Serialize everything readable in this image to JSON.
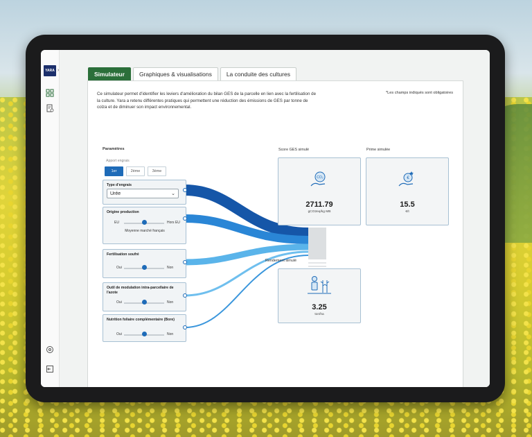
{
  "tabs": [
    {
      "label": "Simulateur",
      "active": true
    },
    {
      "label": "Graphiques & visualisations",
      "active": false
    },
    {
      "label": "La conduite des cultures",
      "active": false
    }
  ],
  "logo_text": "YARA",
  "intro": "Ce simulateur permet d'identifier les leviers d'amélioration du bilan GES de la parcelle en lien avec la fertilisation de la culture. Yara a retenu différentes pratiques qui permettent une réduction des émissions de GES par tonne de colza et de diminuer son impact environnemental.",
  "required_note": "*Les champs indiqués sont obligatoires",
  "params": {
    "title": "Paramètres",
    "apport_label": "Apport engrais",
    "apport_options": [
      "1er",
      "2ème",
      "3ème"
    ],
    "fertilizer_type_label": "Type d'engrais",
    "fertilizer_type_value": "Urée",
    "origin_label": "Origine production",
    "origin_left": "EU",
    "origin_right": "Hors EU",
    "origin_mid": "Moyenne marché français",
    "sulfur_label": "Fertilisation soufré",
    "sulfur_left": "Oui",
    "sulfur_right": "Non",
    "modulation_label": "Outil de modulation intra-parcellaire de l'azote",
    "modulation_left": "Oui",
    "modulation_right": "Non",
    "foliar_label": "Nutrition foliaire complémentaire (Bore)",
    "foliar_left": "Oui",
    "foliar_right": "Non"
  },
  "outputs": {
    "score_label": "Score GES simulé",
    "score_value": "2711.79",
    "score_unit": "gCO2eq/kg MB",
    "prime_label": "Prime simulée",
    "prime_value": "15.5",
    "prime_unit": "€/t",
    "rendement_label": "Rendement simulé",
    "rendement_value": "3.25",
    "rendement_unit": "ton/ha"
  },
  "colors": {
    "accent_green": "#2b6f3a",
    "primary_blue": "#1e6bb8",
    "flow_dark": "#1556a8",
    "flow_mid": "#2a86d6",
    "flow_light": "#5ab4ea"
  }
}
